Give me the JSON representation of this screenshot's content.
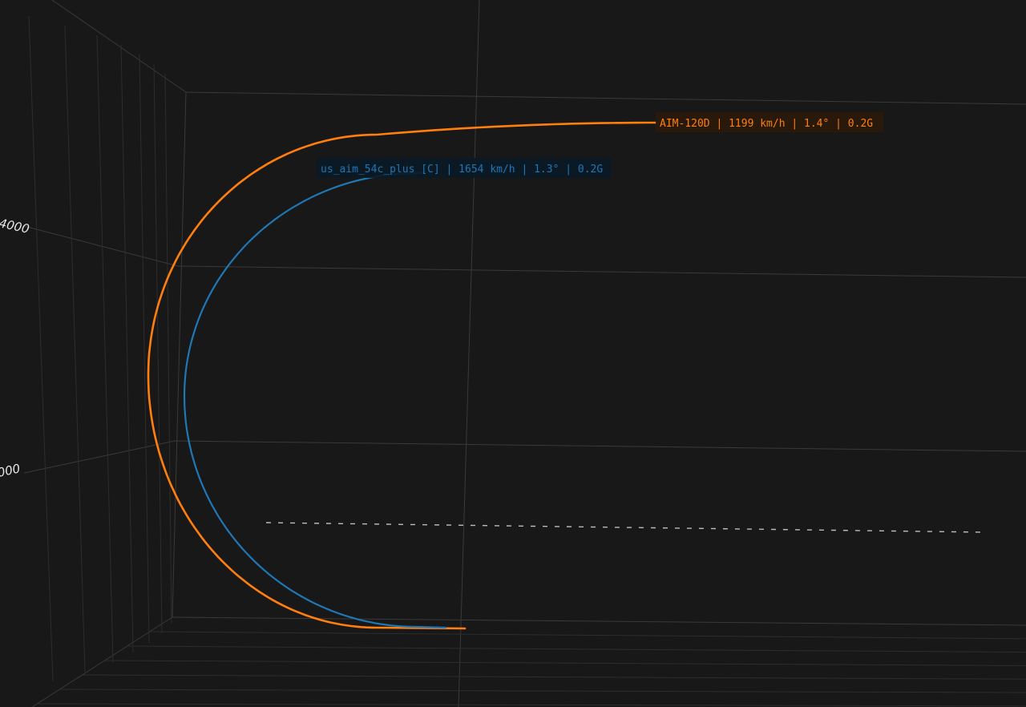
{
  "chart_data": {
    "type": "line",
    "projection": "3d",
    "grid": true,
    "legend": "none",
    "background_color": "#181818",
    "grid_color": "#3a3a3a",
    "z_ticks": [
      "4000",
      "000"
    ],
    "series": [
      {
        "name": "AIM-120D",
        "color": "#ff7f0e",
        "label": "AIM-120D | 1199 km/h | 1.4° | 0.2G",
        "label_bg": "#2a1a0a"
      },
      {
        "name": "us_aim_54c_plus [C]",
        "color": "#1f77b4",
        "label": "us_aim_54c_plus [C] | 1654 km/h | 1.3° | 0.2G",
        "label_bg": "#0b1a26"
      }
    ],
    "reference_line": {
      "style": "dashed",
      "color": "#bdbdbd"
    }
  }
}
